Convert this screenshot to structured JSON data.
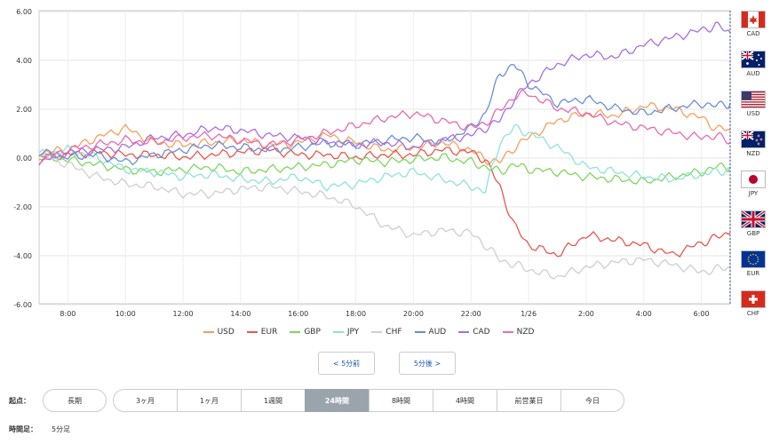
{
  "chart_data": {
    "type": "line",
    "x_ticks": [
      "8:00",
      "10:00",
      "12:00",
      "14:00",
      "16:00",
      "18:00",
      "20:00",
      "22:00",
      "1/26",
      "2:00",
      "4:00",
      "6:00"
    ],
    "y_ticks": [
      "6.00",
      "4.00",
      "2.00",
      "0.00",
      "-2.00",
      "-4.00",
      "-6.00"
    ],
    "ylim": [
      -6,
      6
    ],
    "x_hours": [
      7,
      8,
      9,
      10,
      11,
      12,
      13,
      14,
      15,
      16,
      17,
      18,
      19,
      20,
      21,
      22,
      22.5,
      23,
      23.5,
      24,
      25,
      26,
      27,
      28,
      29,
      30,
      30.5,
      31
    ],
    "grid": true,
    "legend_position": "bottom",
    "series": [
      {
        "name": "USD",
        "color": "#f5a05c",
        "values": [
          0.2,
          0.3,
          0.8,
          1.2,
          0.6,
          0.5,
          0.6,
          0.7,
          0.5,
          0.6,
          0.9,
          0.6,
          0.3,
          0.4,
          0.6,
          0.3,
          -0.1,
          -0.2,
          0.4,
          0.8,
          1.5,
          1.8,
          1.7,
          2.1,
          2.0,
          1.6,
          1.2,
          1.1
        ]
      },
      {
        "name": "EUR",
        "color": "#e8584e",
        "values": [
          0.0,
          0.1,
          0.2,
          0.1,
          0.1,
          0.0,
          0.1,
          0.2,
          0.3,
          0.1,
          0.1,
          0.0,
          0.1,
          0.1,
          0.3,
          0.2,
          -0.1,
          -1.2,
          -2.8,
          -3.6,
          -4.0,
          -3.2,
          -3.4,
          -3.6,
          -4.0,
          -3.5,
          -3.3,
          -3.1
        ]
      },
      {
        "name": "GBP",
        "color": "#7fd65f",
        "values": [
          0.0,
          -0.1,
          -0.3,
          -0.5,
          -0.6,
          -0.5,
          -0.4,
          -0.6,
          -0.5,
          -0.4,
          -0.3,
          -0.1,
          -0.2,
          -0.1,
          0.0,
          -0.2,
          -0.4,
          -0.6,
          -0.3,
          -0.5,
          -0.6,
          -0.8,
          -0.9,
          -1.0,
          -0.8,
          -0.6,
          -0.4,
          -0.4
        ]
      },
      {
        "name": "JPY",
        "color": "#8fe3d8",
        "values": [
          0.1,
          0.3,
          0.0,
          -0.5,
          -0.6,
          -0.8,
          -0.7,
          -0.9,
          -1.0,
          -0.8,
          -1.2,
          -1.1,
          -0.8,
          -0.6,
          -0.9,
          -1.2,
          -1.4,
          0.6,
          1.2,
          1.0,
          0.4,
          -0.4,
          -0.6,
          -0.8,
          -0.9,
          -0.7,
          -0.6,
          -0.5
        ]
      },
      {
        "name": "CHF",
        "color": "#cfcfcf",
        "values": [
          0.1,
          -0.3,
          -0.8,
          -1.1,
          -1.2,
          -1.5,
          -1.5,
          -1.3,
          -1.2,
          -1.4,
          -1.6,
          -2.0,
          -2.8,
          -3.2,
          -3.0,
          -3.1,
          -3.6,
          -4.2,
          -4.4,
          -4.6,
          -4.9,
          -4.5,
          -4.3,
          -4.2,
          -4.4,
          -4.7,
          -4.6,
          -4.5
        ]
      },
      {
        "name": "AUD",
        "color": "#6b8fd6",
        "values": [
          0.2,
          0.0,
          0.1,
          -0.2,
          0.1,
          0.3,
          0.5,
          0.4,
          0.3,
          0.4,
          0.6,
          0.5,
          0.7,
          0.8,
          0.6,
          1.2,
          1.8,
          3.4,
          3.8,
          3.0,
          2.2,
          2.4,
          2.0,
          1.8,
          2.0,
          2.2,
          2.1,
          2.2
        ]
      },
      {
        "name": "CAD",
        "color": "#a86fe0",
        "values": [
          -0.2,
          0.2,
          0.3,
          0.4,
          0.8,
          0.9,
          1.2,
          1.1,
          0.9,
          0.8,
          0.6,
          0.5,
          0.6,
          0.4,
          0.7,
          0.9,
          1.2,
          1.5,
          2.4,
          3.0,
          3.8,
          4.2,
          4.1,
          4.6,
          4.9,
          5.2,
          5.4,
          5.1
        ]
      },
      {
        "name": "NZD",
        "color": "#e86ab0",
        "values": [
          -0.1,
          0.3,
          0.5,
          0.7,
          0.6,
          0.8,
          0.9,
          0.7,
          0.5,
          0.7,
          1.0,
          1.3,
          1.6,
          1.8,
          1.5,
          1.2,
          1.4,
          1.9,
          2.5,
          2.6,
          2.0,
          1.8,
          1.4,
          1.2,
          1.0,
          0.8,
          0.9,
          0.6
        ]
      }
    ]
  },
  "flags": [
    {
      "code": "CAD"
    },
    {
      "code": "AUD"
    },
    {
      "code": "USD"
    },
    {
      "code": "NZD"
    },
    {
      "code": "JPY"
    },
    {
      "code": "GBP"
    },
    {
      "code": "EUR"
    },
    {
      "code": "CHF"
    }
  ],
  "nav": {
    "prev_label": "< 5分前",
    "next_label": "5分後 >"
  },
  "start": {
    "label": "起点：",
    "long_label": "長期",
    "options": [
      "3ヶ月",
      "1ヶ月",
      "1週間",
      "24時間",
      "8時間",
      "4時間",
      "前営業日",
      "今日"
    ],
    "active": "24時間"
  },
  "interval": {
    "label": "時間足：",
    "value": "5分足"
  }
}
